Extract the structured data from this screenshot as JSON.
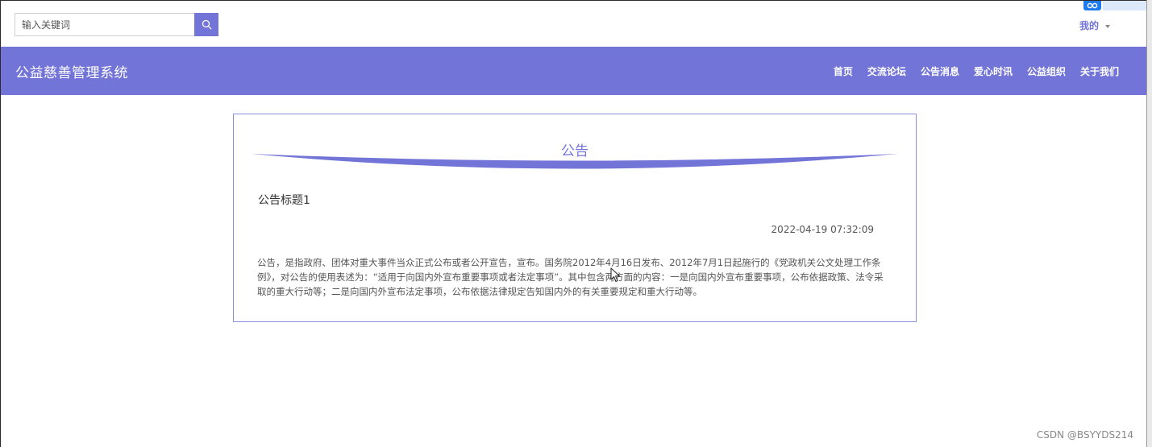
{
  "search": {
    "placeholder": "输入关键词",
    "button_icon": "search-icon"
  },
  "user_menu": {
    "label": "我的",
    "icon": "caret-down-icon"
  },
  "brand": {
    "title": "公益慈善管理系统"
  },
  "nav": {
    "items": [
      {
        "label": "首页"
      },
      {
        "label": "交流论坛"
      },
      {
        "label": "公告消息"
      },
      {
        "label": "爱心时讯"
      },
      {
        "label": "公益组织"
      },
      {
        "label": "关于我们"
      }
    ]
  },
  "announcement": {
    "heading": "公告",
    "title": "公告标题1",
    "published_at": "2022-04-19 07:32:09",
    "body": "公告，是指政府、团体对重大事件当众正式公布或者公开宣告，宣布。国务院2012年4月16日发布、2012年7月1日起施行的《党政机关公文处理工作条例》，对公告的使用表述为：“适用于向国内外宣布重要事项或者法定事项”。其中包含两方面的内容：一是向国内外宣布重要事项，公布依据政策、法令采取的重大行动等；二是向国内外宣布法定事项，公布依据法律规定告知国内外的有关重要规定和重大行动等。"
  },
  "watermark": "CSDN @BSYYDS214",
  "colors": {
    "accent": "#7374d8",
    "nav_text": "#ffffff",
    "card_border": "#8c8ddf",
    "body_text": "#555555"
  }
}
